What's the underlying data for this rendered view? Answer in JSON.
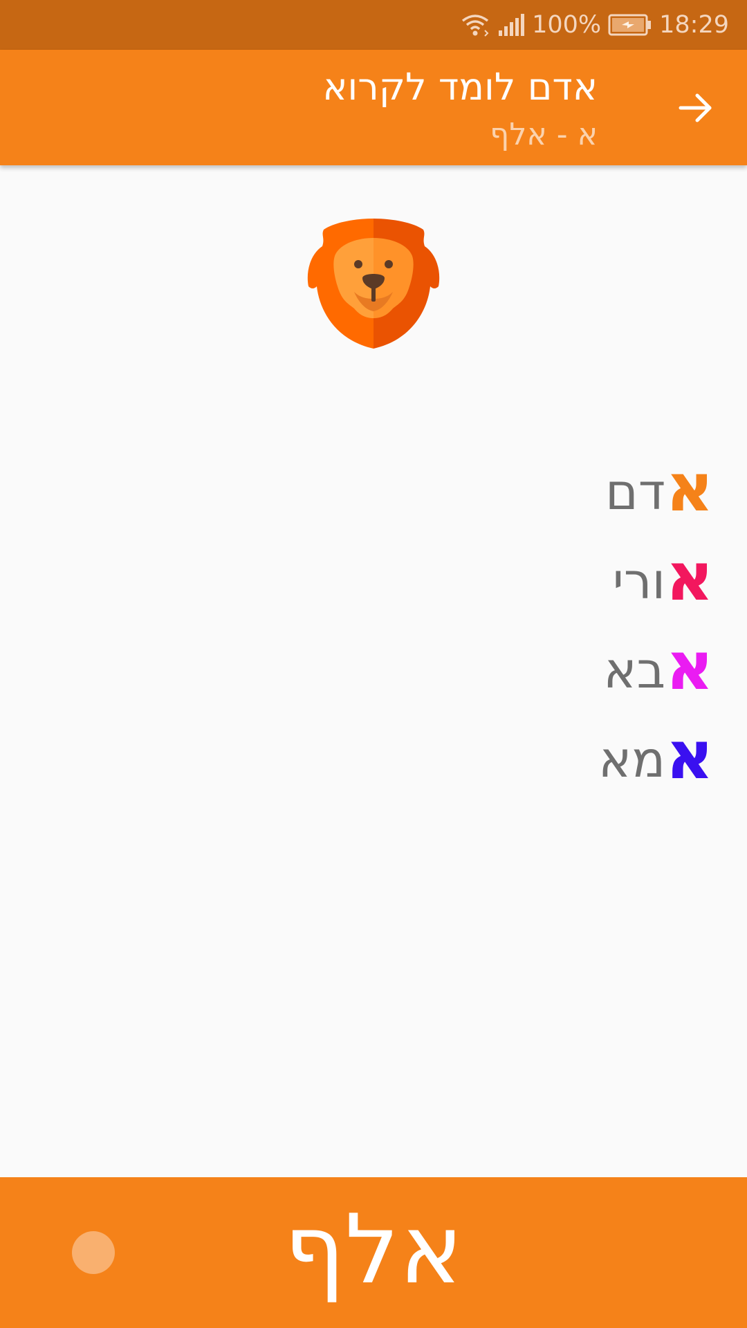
{
  "status_bar": {
    "battery_percent": "100%",
    "time": "18:29",
    "icons": [
      "wifi-icon",
      "signal-icon",
      "battery-charging-icon"
    ]
  },
  "app_bar": {
    "title": "אדם לומד לקרוא",
    "subtitle": "א - אלף",
    "nav_icon": "arrow-forward-icon"
  },
  "content": {
    "picture": "lion-icon",
    "words": [
      {
        "letter": "א",
        "rest": "דם",
        "color": "#f58219"
      },
      {
        "letter": "א",
        "rest": "ורי",
        "color": "#f2175e"
      },
      {
        "letter": "א",
        "rest": "בא",
        "color": "#ea1cf2"
      },
      {
        "letter": "א",
        "rest": "מא",
        "color": "#3a10f0"
      }
    ]
  },
  "bottom_bar": {
    "label": "אלף"
  },
  "colors": {
    "status_bar": "#c66713",
    "primary": "#f58219",
    "background": "#fafafa",
    "word_text": "#6f6f6f"
  }
}
